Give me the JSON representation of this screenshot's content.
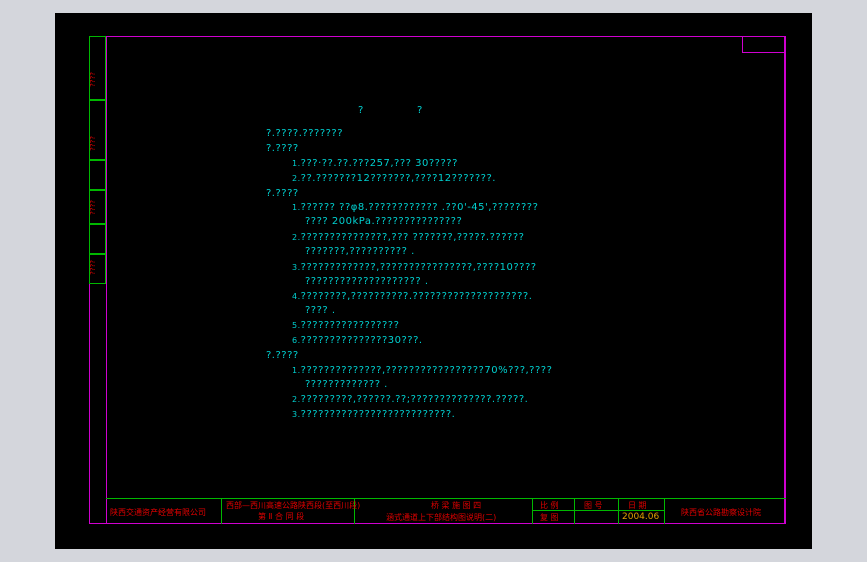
{
  "heading": {
    "left": "?",
    "right": "?"
  },
  "side_labels": [
    "????",
    "????",
    "????",
    "????"
  ],
  "lines": [
    {
      "indent": 0,
      "text": "?.????.???????"
    },
    {
      "indent": 0,
      "text": "?.????"
    },
    {
      "indent": 1,
      "num": "1.",
      "text": "???·??.??.???257,??? 30?????"
    },
    {
      "indent": 1,
      "num": "2.",
      "text": "??.???????12???????,????12???????."
    },
    {
      "indent": 0,
      "text": "?.????"
    },
    {
      "indent": 1,
      "num": "1.",
      "text": "?????? ??φ8.????????????  .??0'-45',????????"
    },
    {
      "indent": 2,
      "text": "???? 200kPa.???????????????"
    },
    {
      "indent": 1,
      "num": "2.",
      "text": "???????????????,??? ???????,?????.??????"
    },
    {
      "indent": 2,
      "text": "???????,??????????   ."
    },
    {
      "indent": 1,
      "num": "3.",
      "text": "?????????????,????????????????,????10????"
    },
    {
      "indent": 2,
      "text": "????????????????????    ."
    },
    {
      "indent": 1,
      "num": "4.",
      "text": "????????,??????????.????????????????????."
    },
    {
      "indent": 2,
      "text": "???? ."
    },
    {
      "indent": 1,
      "num": "5.",
      "text": "?????????????????"
    },
    {
      "indent": 1,
      "num": "6.",
      "text": "???????????????30???."
    },
    {
      "indent": 0,
      "text": "?.????"
    },
    {
      "indent": 1,
      "num": "1.",
      "text": "??????????????,?????????????????70%???,????"
    },
    {
      "indent": 2,
      "text": "?????????????   ."
    },
    {
      "indent": 1,
      "num": "2.",
      "text": "?????????,??????.??;??????????????.?????."
    },
    {
      "indent": 1,
      "num": "3.",
      "text": "??????????????????????????."
    }
  ],
  "title_block": {
    "company": "陕西交通资产经营有限公司",
    "project_line1": "西部—西川高速公路陕西段(至西川段)",
    "project_line2": "第 Ⅱ 合 同 段",
    "drawing_line1": "桥 梁 施 图 四",
    "drawing_line2": "涵式通道上下部结构图说明(二)",
    "scale_label": "比 例",
    "review_label": "复 图",
    "sheet_label": "图 号",
    "date_label": "日 期",
    "date_value": "2004.06",
    "designer": "陕西省公路勘察设计院"
  },
  "colors": {
    "frame": "#d000d0",
    "grid": "#00b800",
    "text": "#00d0d0",
    "title_text": "#e00000",
    "date_text": "#e0a000"
  }
}
